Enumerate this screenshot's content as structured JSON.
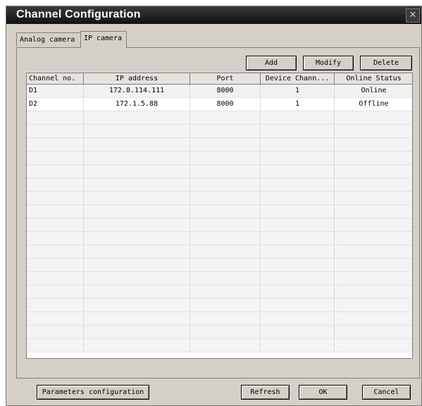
{
  "window": {
    "title": "Channel Configuration",
    "close_glyph": "✕"
  },
  "tabs": [
    {
      "label": "Analog camera",
      "active": false
    },
    {
      "label": "IP camera",
      "active": true
    }
  ],
  "toolbar": {
    "add_label": "Add",
    "modify_label": "Modify",
    "delete_label": "Delete"
  },
  "table": {
    "headers": [
      "Channel no.",
      "IP address",
      "Port",
      "Device Chann...",
      "Online Status"
    ],
    "rows": [
      {
        "channel": "D1",
        "ip": "172.8.114.111",
        "port": "8000",
        "device_channel": "1",
        "status": "Online"
      },
      {
        "channel": "D2",
        "ip": "172.1.5.88",
        "port": "8000",
        "device_channel": "1",
        "status": "Offline"
      }
    ]
  },
  "footer": {
    "params_label": "Parameters configuration",
    "refresh_label": "Refresh",
    "ok_label": "OK",
    "cancel_label": "Cancel"
  }
}
